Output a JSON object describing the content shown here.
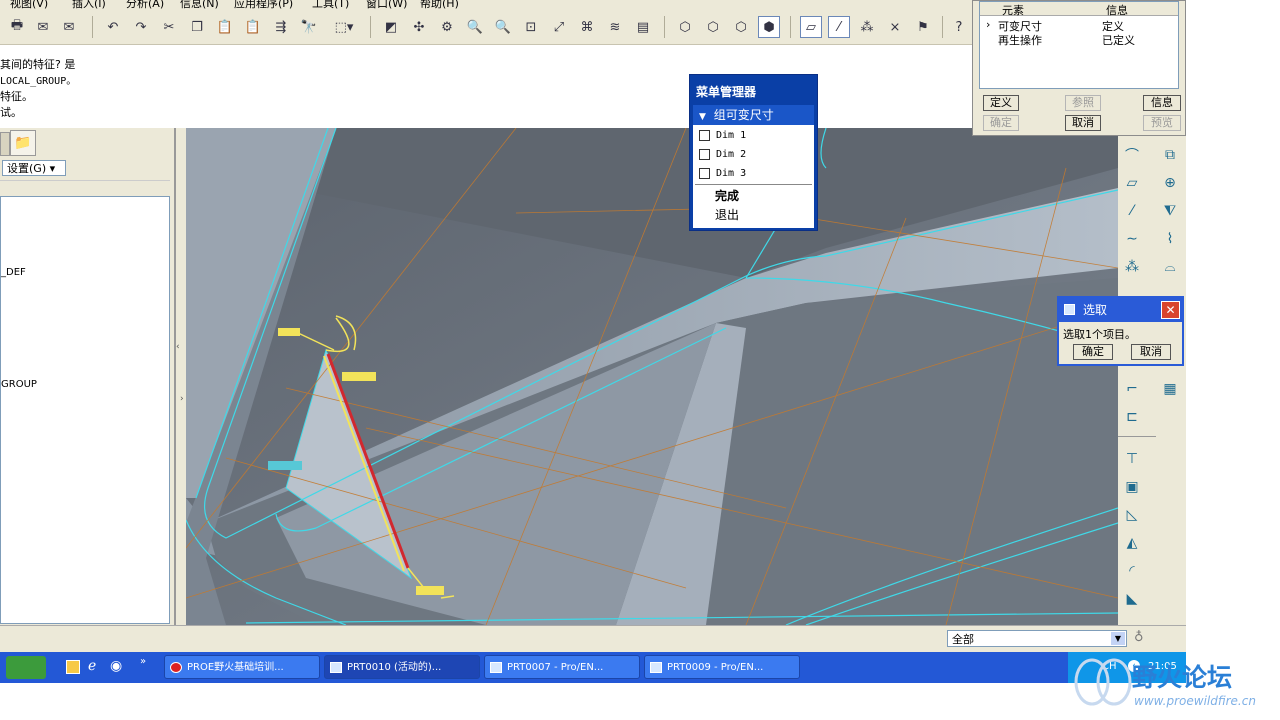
{
  "menubar": {
    "items": [
      "视图(V)",
      "插入(I)",
      "分析(A)",
      "信息(N)",
      "应用程序(P)",
      "工具(T)",
      "窗口(W)",
      "帮助(H)"
    ]
  },
  "messages": [
    "其间的特征?   是",
    " LOCAL_GROUP。",
    "特征。",
    "试。"
  ],
  "leftpanel": {
    "settings_label": "设置(G) ▾",
    "tree_items": [
      "_DEF",
      "GROUP"
    ]
  },
  "elem_dialog": {
    "headers": [
      "元素",
      "信息"
    ],
    "rows": [
      {
        "element": "可变尺寸",
        "info": "定义"
      },
      {
        "element": "再生操作",
        "info": "已定义"
      }
    ],
    "buttons": {
      "define": "定义",
      "ref": "参照",
      "info": "信息",
      "ok": "确定",
      "cancel": "取消",
      "preview": "预览"
    }
  },
  "menu_manager": {
    "title": "菜单管理器",
    "submenu": "组可变尺寸",
    "dims": [
      "Dim 1",
      "Dim 2",
      "Dim 3"
    ],
    "done": "完成",
    "quit": "退出"
  },
  "select_dialog": {
    "title": "选取",
    "message": "选取1个项目。",
    "ok": "确定",
    "cancel": "取消"
  },
  "filter": {
    "value": "全部"
  },
  "taskbar": {
    "tasks": [
      {
        "label": "PROE野火基础培训...",
        "active": false
      },
      {
        "label": "PRT0010 (活动的)...",
        "active": true
      },
      {
        "label": "PRT0007 - Pro/EN...",
        "active": false
      },
      {
        "label": "PRT0009 - Pro/EN...",
        "active": false
      }
    ],
    "tray_lang": "CH",
    "clock": "21:05"
  },
  "watermark": {
    "title": "野火论坛",
    "url": "www.proewildfire.cn"
  },
  "colors": {
    "accent": "#2a5bd7",
    "menu_blue": "#0a3fa6",
    "edge_cyan": "#3fd9e8",
    "guide_orange": "#c47a2e",
    "dim_yellow": "#f2e35a",
    "sketch_red": "#d2282e"
  }
}
